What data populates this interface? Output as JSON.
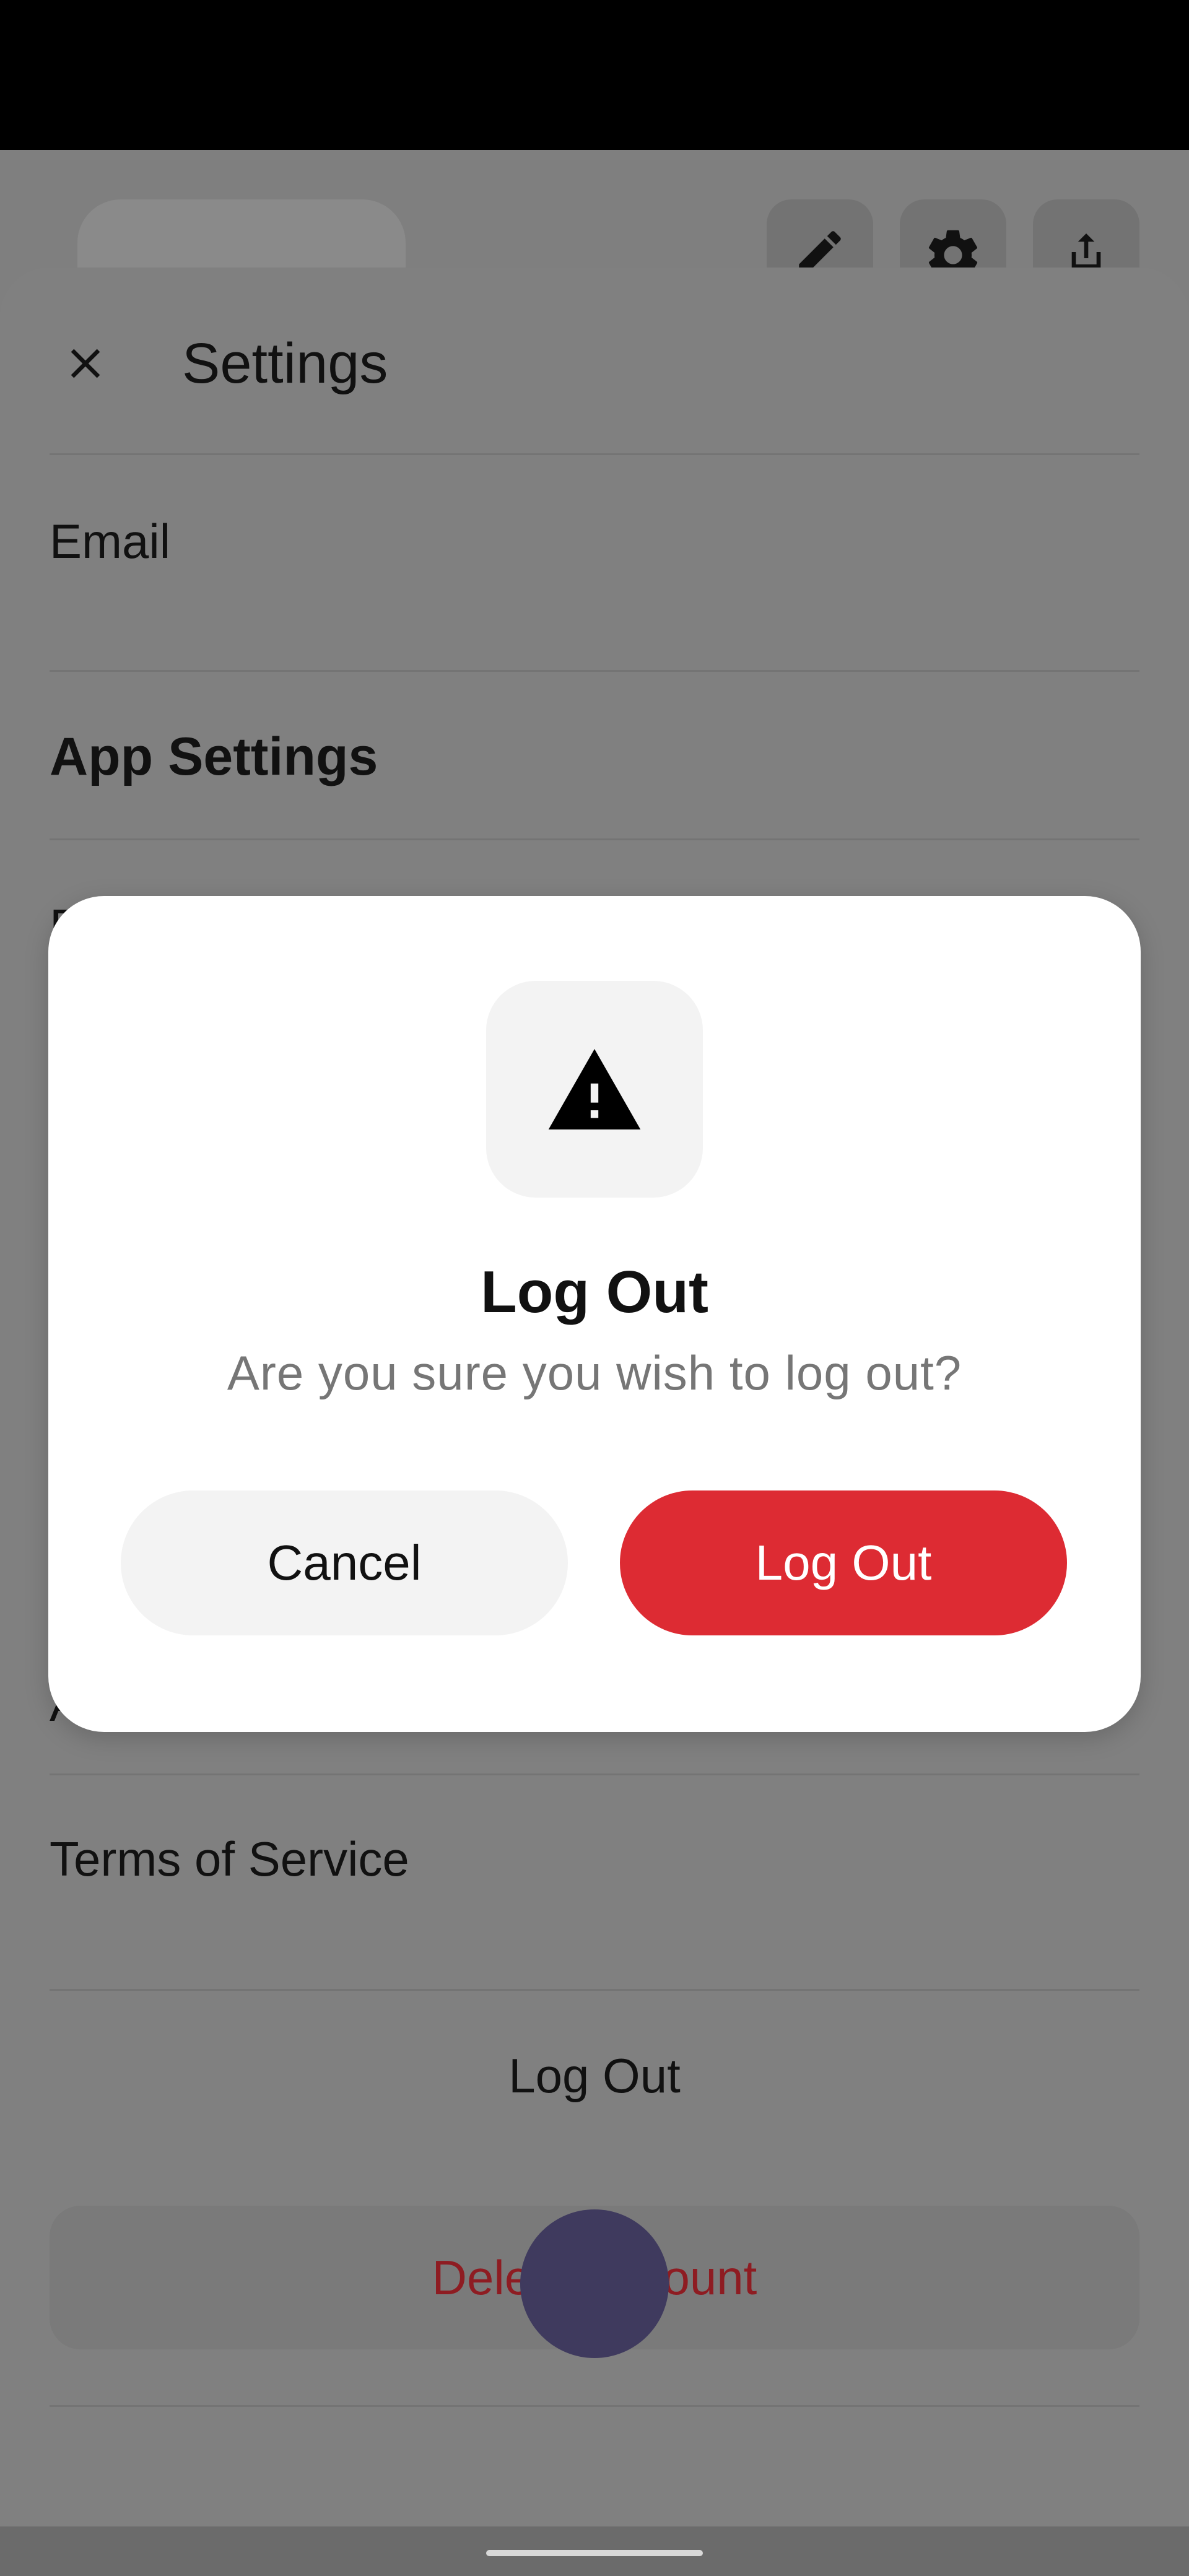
{
  "settings": {
    "title": "Settings",
    "email_label": "Email",
    "app_settings_heading": "App Settings",
    "partial_row_letter_1": "D",
    "partial_row_letter_2": "A",
    "terms_label": "Terms of Service",
    "logout_label": "Log Out",
    "delete_account_label": "Delete Account"
  },
  "dialog": {
    "icon": "warning-icon",
    "title": "Log Out",
    "message": "Are you sure you wish to log out?",
    "cancel_label": "Cancel",
    "confirm_label": "Log Out"
  },
  "colors": {
    "confirm": "#dd2b33",
    "delete_text": "#8e1c22",
    "scrim": "#7f7f7f"
  }
}
